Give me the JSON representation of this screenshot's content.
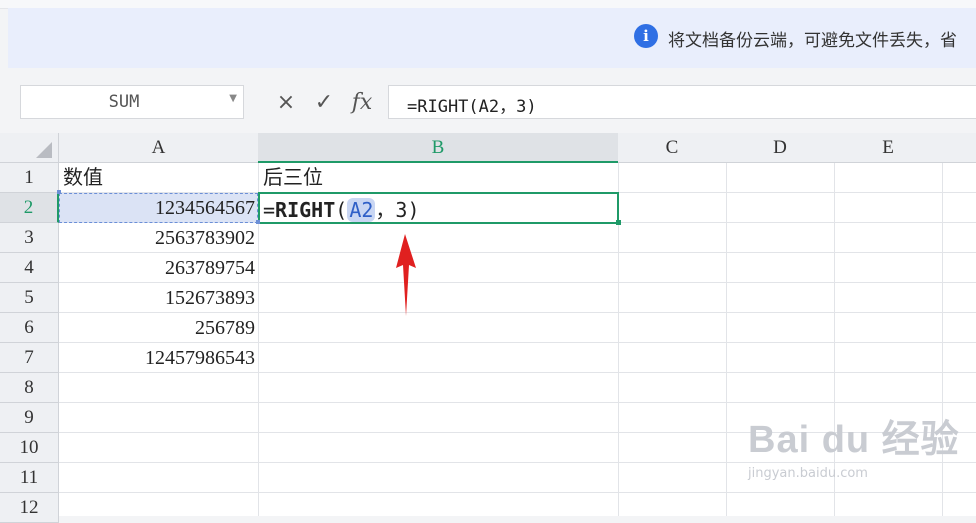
{
  "notice": {
    "text": "将文档备份云端，可避免文件丢失，省",
    "icon": "info-icon"
  },
  "formula_bar": {
    "name_box": "SUM",
    "cancel_icon": "×",
    "confirm_icon": "✓",
    "fx_label": "fx",
    "formula": "=RIGHT(A2，3)"
  },
  "columns": [
    "A",
    "B",
    "C",
    "D",
    "E"
  ],
  "rows": [
    "1",
    "2",
    "3",
    "4",
    "5",
    "6",
    "7",
    "8",
    "9",
    "10",
    "11",
    "12"
  ],
  "cells": {
    "A1": "数值",
    "B1": "后三位",
    "A_values": [
      "1234564567",
      "2563783902",
      "263789754",
      "152673893",
      "256789",
      "12457986543"
    ],
    "B2": {
      "prefix": "=",
      "fn": "RIGHT",
      "open": "(",
      "ref": "A2",
      "sep": "，",
      "arg": "3",
      "close": ")"
    }
  },
  "watermark": {
    "main": "Bai du 经验",
    "sub": "jingyan.baidu.com"
  },
  "colors": {
    "accent_green": "#1f9a68",
    "arrow_red": "#e02020",
    "info_blue": "#2f6fe4"
  }
}
